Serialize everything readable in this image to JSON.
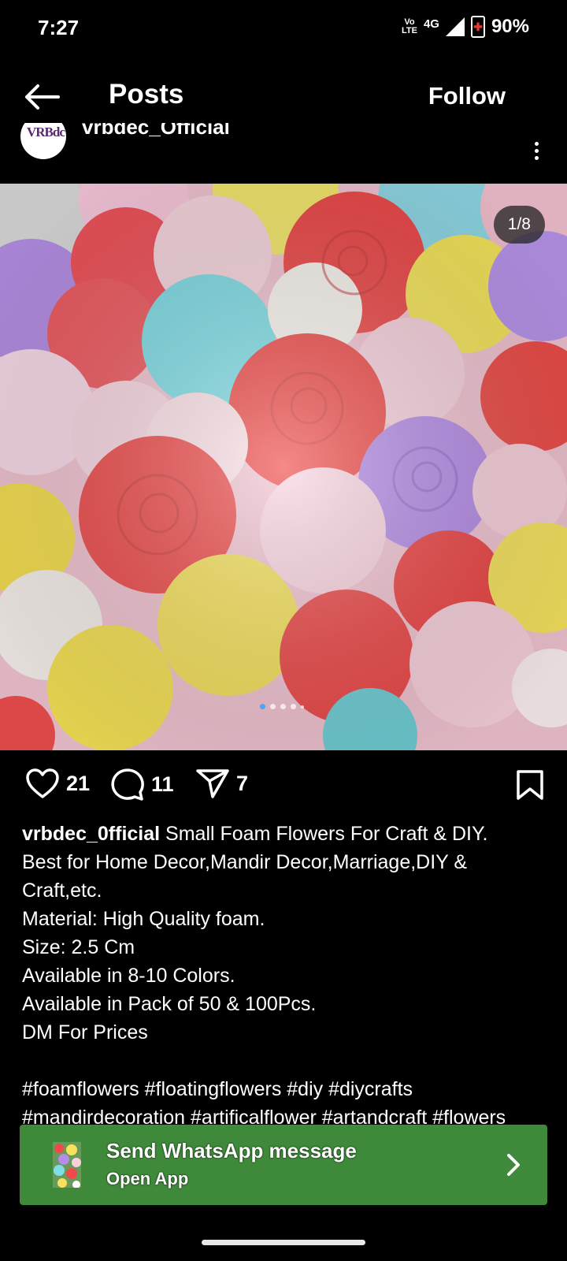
{
  "status": {
    "time": "7:27",
    "volte_top": "Vo",
    "volte_bottom": "LTE",
    "network": "4G",
    "battery": "90%"
  },
  "header": {
    "title": "Posts",
    "follow_label": "Follow",
    "back_icon": "arrow-left-icon"
  },
  "author": {
    "username": "vrbdec_Official",
    "avatar_text": "VRBdc"
  },
  "media": {
    "counter": "1/8",
    "image_alt": "colorful foam roses"
  },
  "actions": {
    "likes": "21",
    "comments": "11",
    "shares": "7"
  },
  "caption": {
    "username": "vrbdec_0fficial",
    "lines": [
      "Small Foam Flowers For Craft & DIY.",
      "Best for Home Decor,Mandir Decor,Marriage,DIY &",
      "Craft,etc.",
      "Material: High Quality foam.",
      "Size: 2.5 Cm",
      "Available in 8-10 Colors.",
      "Available in Pack of 50 & 100Pcs.",
      "DM For Prices"
    ],
    "hashtags_1": "#foamflowers #floatingflowers #diy #diycrafts",
    "hashtags_2": "#mandirdecoration #artificalflower #artandcraft #flowers"
  },
  "cta": {
    "title": "Send WhatsApp message",
    "subtitle": "Open App",
    "color": "#3f8a3a"
  }
}
